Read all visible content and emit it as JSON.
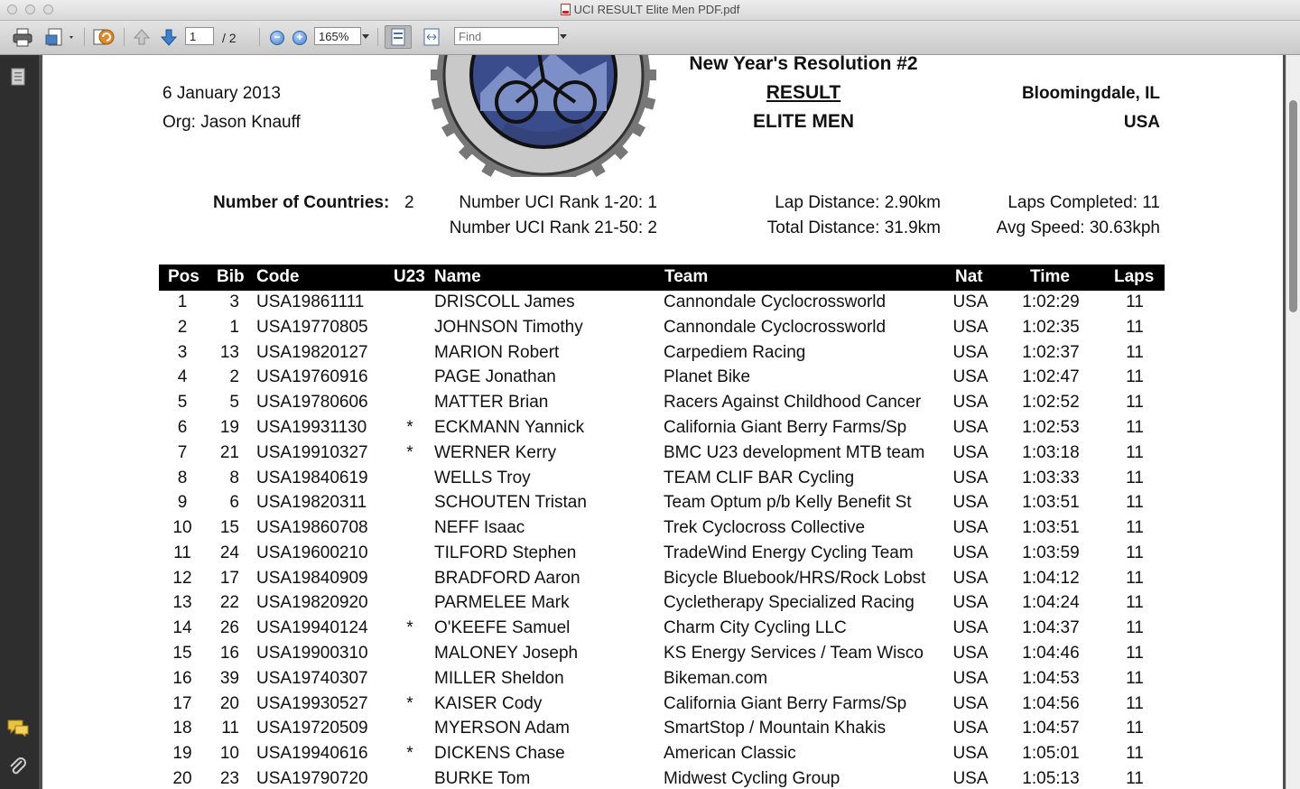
{
  "window": {
    "title": "UCI RESULT Elite Men PDF.pdf"
  },
  "toolbar": {
    "page_current": "1",
    "page_total": "/ 2",
    "zoom": "165%",
    "find_placeholder": "Find"
  },
  "doc": {
    "date": "6 January 2013",
    "org": "Org: Jason Knauff",
    "event_title": "New Year's Resolution #2",
    "result_label": "RESULT",
    "category": "ELITE MEN",
    "location": "Bloomingdale, IL",
    "country": "USA",
    "stats": {
      "countries_label": "Number of Countries:",
      "countries_value": "2",
      "uci_rank_1_20": "Number UCI Rank 1-20: 1",
      "uci_rank_21_50": "Number UCI Rank 21-50: 2",
      "lap_distance": "Lap Distance: 2.90km",
      "total_distance": "Total Distance: 31.9km",
      "laps_completed": "Laps Completed: 11",
      "avg_speed": "Avg Speed: 30.63kph"
    }
  },
  "table": {
    "headers": {
      "pos": "Pos",
      "bib": "Bib",
      "code": "Code",
      "u23": "U23",
      "name": "Name",
      "team": "Team",
      "nat": "Nat",
      "time": "Time",
      "laps": "Laps"
    },
    "rows": [
      {
        "pos": "1",
        "bib": "3",
        "code": "USA19861111",
        "u23": "",
        "name": "DRISCOLL James",
        "team": "Cannondale Cyclocrossworld",
        "nat": "USA",
        "time": "1:02:29",
        "laps": "11"
      },
      {
        "pos": "2",
        "bib": "1",
        "code": "USA19770805",
        "u23": "",
        "name": "JOHNSON Timothy",
        "team": "Cannondale Cyclocrossworld",
        "nat": "USA",
        "time": "1:02:35",
        "laps": "11"
      },
      {
        "pos": "3",
        "bib": "13",
        "code": "USA19820127",
        "u23": "",
        "name": "MARION Robert",
        "team": "Carpediem Racing",
        "nat": "USA",
        "time": "1:02:37",
        "laps": "11"
      },
      {
        "pos": "4",
        "bib": "2",
        "code": "USA19760916",
        "u23": "",
        "name": "PAGE Jonathan",
        "team": "Planet Bike",
        "nat": "USA",
        "time": "1:02:47",
        "laps": "11"
      },
      {
        "pos": "5",
        "bib": "5",
        "code": "USA19780606",
        "u23": "",
        "name": "MATTER Brian",
        "team": "Racers Against Childhood Cancer",
        "nat": "USA",
        "time": "1:02:52",
        "laps": "11"
      },
      {
        "pos": "6",
        "bib": "19",
        "code": "USA19931130",
        "u23": "*",
        "name": "ECKMANN Yannick",
        "team": "California Giant Berry Farms/Sp",
        "nat": "USA",
        "time": "1:02:53",
        "laps": "11"
      },
      {
        "pos": "7",
        "bib": "21",
        "code": "USA19910327",
        "u23": "*",
        "name": "WERNER Kerry",
        "team": "BMC U23 development MTB team",
        "nat": "USA",
        "time": "1:03:18",
        "laps": "11"
      },
      {
        "pos": "8",
        "bib": "8",
        "code": "USA19840619",
        "u23": "",
        "name": "WELLS Troy",
        "team": "TEAM CLIF BAR Cycling",
        "nat": "USA",
        "time": "1:03:33",
        "laps": "11"
      },
      {
        "pos": "9",
        "bib": "6",
        "code": "USA19820311",
        "u23": "",
        "name": "SCHOUTEN Tristan",
        "team": "Team Optum p/b Kelly Benefit St",
        "nat": "USA",
        "time": "1:03:51",
        "laps": "11"
      },
      {
        "pos": "10",
        "bib": "15",
        "code": "USA19860708",
        "u23": "",
        "name": "NEFF Isaac",
        "team": "Trek Cyclocross Collective",
        "nat": "USA",
        "time": "1:03:51",
        "laps": "11"
      },
      {
        "pos": "11",
        "bib": "24",
        "code": "USA19600210",
        "u23": "",
        "name": "TILFORD Stephen",
        "team": "TradeWind Energy Cycling Team",
        "nat": "USA",
        "time": "1:03:59",
        "laps": "11"
      },
      {
        "pos": "12",
        "bib": "17",
        "code": "USA19840909",
        "u23": "",
        "name": "BRADFORD Aaron",
        "team": "Bicycle Bluebook/HRS/Rock Lobst",
        "nat": "USA",
        "time": "1:04:12",
        "laps": "11"
      },
      {
        "pos": "13",
        "bib": "22",
        "code": "USA19820920",
        "u23": "",
        "name": "PARMELEE Mark",
        "team": "Cycletherapy Specialized Racing",
        "nat": "USA",
        "time": "1:04:24",
        "laps": "11"
      },
      {
        "pos": "14",
        "bib": "26",
        "code": "USA19940124",
        "u23": "*",
        "name": "O'KEEFE Samuel",
        "team": "Charm City Cycling LLC",
        "nat": "USA",
        "time": "1:04:37",
        "laps": "11"
      },
      {
        "pos": "15",
        "bib": "16",
        "code": "USA19900310",
        "u23": "",
        "name": "MALONEY Joseph",
        "team": "KS Energy Services / Team Wisco",
        "nat": "USA",
        "time": "1:04:46",
        "laps": "11"
      },
      {
        "pos": "16",
        "bib": "39",
        "code": "USA19740307",
        "u23": "",
        "name": "MILLER Sheldon",
        "team": "Bikeman.com",
        "nat": "USA",
        "time": "1:04:53",
        "laps": "11"
      },
      {
        "pos": "17",
        "bib": "20",
        "code": "USA19930527",
        "u23": "*",
        "name": "KAISER Cody",
        "team": "California Giant Berry Farms/Sp",
        "nat": "USA",
        "time": "1:04:56",
        "laps": "11"
      },
      {
        "pos": "18",
        "bib": "11",
        "code": "USA19720509",
        "u23": "",
        "name": "MYERSON Adam",
        "team": "SmartStop / Mountain Khakis",
        "nat": "USA",
        "time": "1:04:57",
        "laps": "11"
      },
      {
        "pos": "19",
        "bib": "10",
        "code": "USA19940616",
        "u23": "*",
        "name": "DICKENS Chase",
        "team": "American Classic",
        "nat": "USA",
        "time": "1:05:01",
        "laps": "11"
      },
      {
        "pos": "20",
        "bib": "23",
        "code": "USA19790720",
        "u23": "",
        "name": "BURKE Tom",
        "team": "Midwest Cycling Group",
        "nat": "USA",
        "time": "1:05:13",
        "laps": "11"
      }
    ]
  },
  "icons": [
    "print-icon",
    "export-icon",
    "sync-icon",
    "page-up-icon",
    "page-down-icon",
    "zoom-out-icon",
    "zoom-in-icon",
    "fit-page-icon",
    "fit-width-icon",
    "thumbnails-icon",
    "comments-icon",
    "attachment-icon",
    "cyclocross-logo"
  ]
}
